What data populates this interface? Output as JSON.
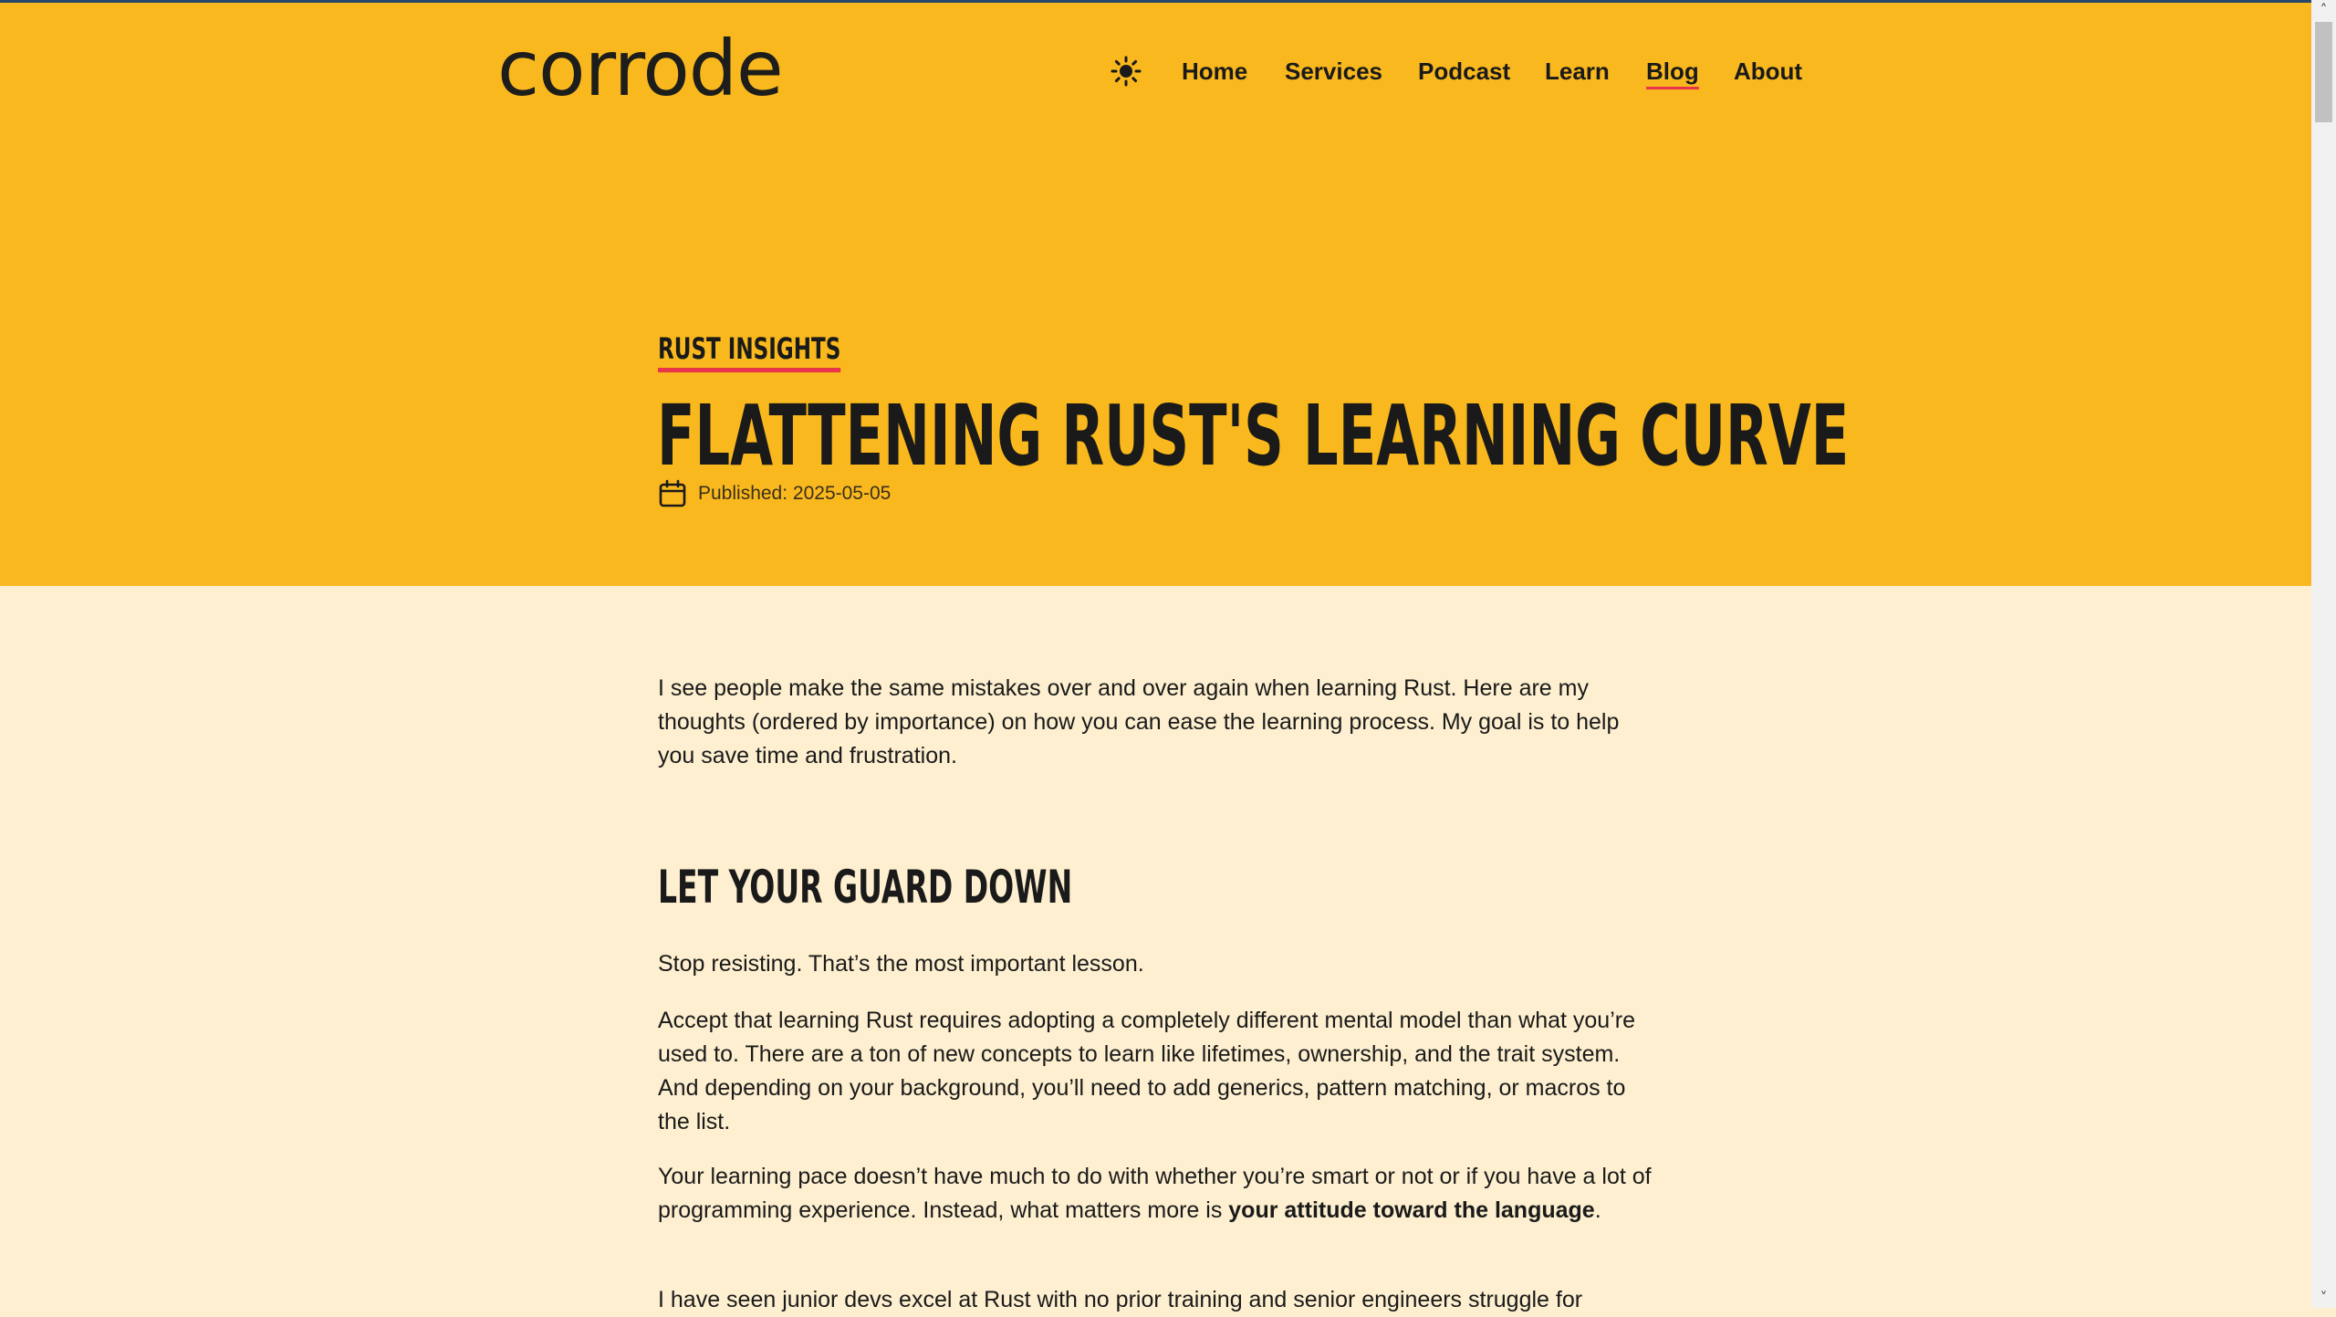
{
  "header": {
    "logo": "corrode",
    "theme_toggle_icon": "sun-icon",
    "nav": [
      {
        "label": "Home"
      },
      {
        "label": "Services"
      },
      {
        "label": "Podcast"
      },
      {
        "label": "Learn"
      },
      {
        "label": "Blog",
        "active": true
      },
      {
        "label": "About"
      }
    ]
  },
  "article": {
    "category": "RUST INSIGHTS",
    "title": "FLATTENING RUST'S LEARNING CURVE",
    "published": "Published: 2025-05-05",
    "intro": "I see people make the same mistakes over and over again when learning Rust. Here are my thoughts (ordered by importance) on how you can ease the learning process. My goal is to help you save time and frustration.",
    "section1": {
      "heading": "LET YOUR GUARD DOWN",
      "p1": "Stop resisting. That’s the most important lesson.",
      "p2": "Accept that learning Rust requires adopting a completely different mental model than what you’re used to. There are a ton of new concepts to learn like lifetimes, ownership, and the trait system. And depending on your background, you’ll need to add generics, pattern matching, or macros to the list.",
      "p3_start": "Your learning pace doesn’t have much to do with whether you’re smart or not or if you have a lot of programming experience. Instead, what matters more is ",
      "p3_bold": "your attitude toward the language",
      "p3_end": ".",
      "p4": "I have seen junior devs excel at Rust with no prior training and senior engineers struggle for"
    }
  },
  "colors": {
    "hero_bg": "#f9b81d",
    "page_bg": "#fdefcf",
    "accent": "#e8344b",
    "text": "#1a1a1a"
  }
}
